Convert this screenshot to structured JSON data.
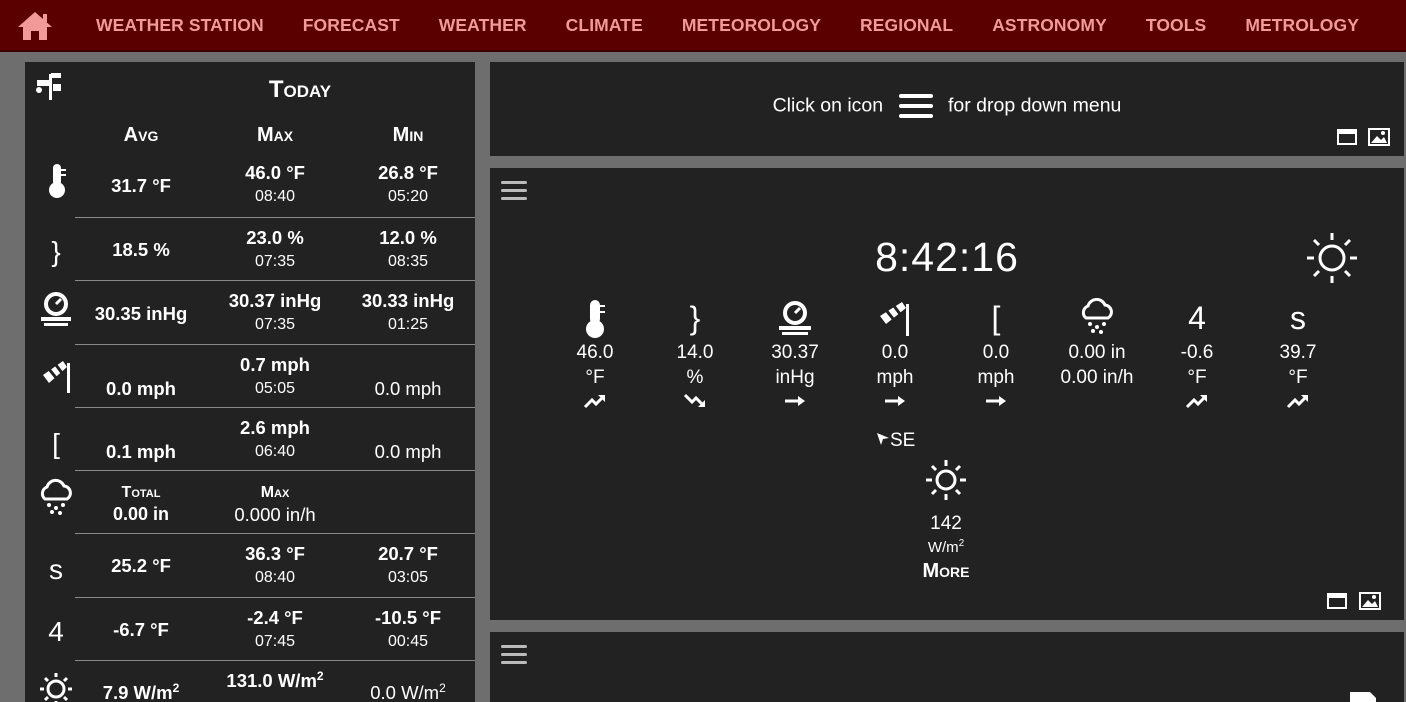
{
  "nav": {
    "home_icon": "home-icon",
    "items": [
      "WEATHER STATION",
      "FORECAST",
      "WEATHER",
      "CLIMATE",
      "METEOROLOGY",
      "REGIONAL",
      "ASTRONOMY",
      "TOOLS",
      "METROLOGY"
    ]
  },
  "colors": {
    "nav_bg": "#5a0000",
    "nav_text": "#f29a9a",
    "panel_bg": "#222222",
    "page_bg": "#6e6e6e"
  },
  "today": {
    "title": "Today",
    "headers": {
      "avg": "Avg",
      "max": "Max",
      "min": "Min"
    },
    "rows": [
      {
        "icon": "thermometer-icon",
        "avg": "31.7 °F",
        "max": "46.0 °F",
        "max_time": "08:40",
        "min": "26.8 °F",
        "min_time": "05:20"
      },
      {
        "icon": "humidity-icon",
        "glyph": "}",
        "avg": "18.5 %",
        "max": "23.0 %",
        "max_time": "07:35",
        "min": "12.0 %",
        "min_time": "08:35"
      },
      {
        "icon": "barometer-icon",
        "avg": "30.35 inHg",
        "max": "30.37 inHg",
        "max_time": "07:35",
        "min": "30.33 inHg",
        "min_time": "01:25"
      },
      {
        "icon": "windsock-icon",
        "avg": "0.0 mph",
        "max": "0.7 mph",
        "max_time": "05:05",
        "min": "0.0 mph"
      },
      {
        "icon": "wind-gust-icon",
        "glyph": "[",
        "avg": "0.1 mph",
        "max": "2.6 mph",
        "max_time": "06:40",
        "min": "0.0 mph"
      },
      {
        "icon": "rain-icon",
        "total_label": "Total",
        "total": "0.00 in",
        "max_label": "Max",
        "max": "0.000 in/h"
      },
      {
        "icon": "dewpoint-icon",
        "glyph": "s",
        "avg": "25.2 °F",
        "max": "36.3 °F",
        "max_time": "08:40",
        "min": "20.7 °F",
        "min_time": "03:05"
      },
      {
        "icon": "windchill-icon",
        "glyph": "4",
        "avg": "-6.7 °F",
        "max": "-2.4 °F",
        "max_time": "07:45",
        "min": "-10.5 °F",
        "min_time": "00:45"
      },
      {
        "icon": "sun-icon",
        "avg": "7.9 W/m",
        "max": "131.0 W/m",
        "min": "0.0 W/m",
        "sup": "2"
      }
    ]
  },
  "hint": {
    "before": "Click on icon",
    "after": "for drop down menu"
  },
  "current": {
    "time": "8:42:16",
    "weather_icon": "sun-icon",
    "sensors": [
      {
        "icon": "thermometer-icon",
        "value": "46.0",
        "unit": "°F",
        "trend": "trend-up-icon"
      },
      {
        "icon": "humidity-icon",
        "glyph": "}",
        "value": "14.0",
        "unit": "%",
        "trend": "trend-down-icon"
      },
      {
        "icon": "barometer-icon",
        "value": "30.37",
        "unit": "inHg",
        "trend": "trend-steady-icon"
      },
      {
        "icon": "windsock-icon",
        "value": "0.0",
        "unit": "mph",
        "trend": "trend-steady-icon"
      },
      {
        "icon": "wind-gust-icon",
        "glyph": "[",
        "value": "0.0",
        "unit": "mph",
        "trend": "trend-steady-icon"
      },
      {
        "icon": "rain-icon",
        "value": "0.00 in",
        "unit": "0.00 in/h"
      },
      {
        "icon": "windchill-icon",
        "glyph": "4",
        "value": "-0.6",
        "unit": "°F",
        "trend": "trend-up-icon"
      },
      {
        "icon": "dewpoint-icon",
        "glyph": "s",
        "value": "39.7",
        "unit": "°F",
        "trend": "trend-up-icon"
      }
    ],
    "wind_dir": "SE",
    "solar": {
      "value": "142",
      "unit": "W/m",
      "unit_sup": "2",
      "more": "More"
    }
  }
}
